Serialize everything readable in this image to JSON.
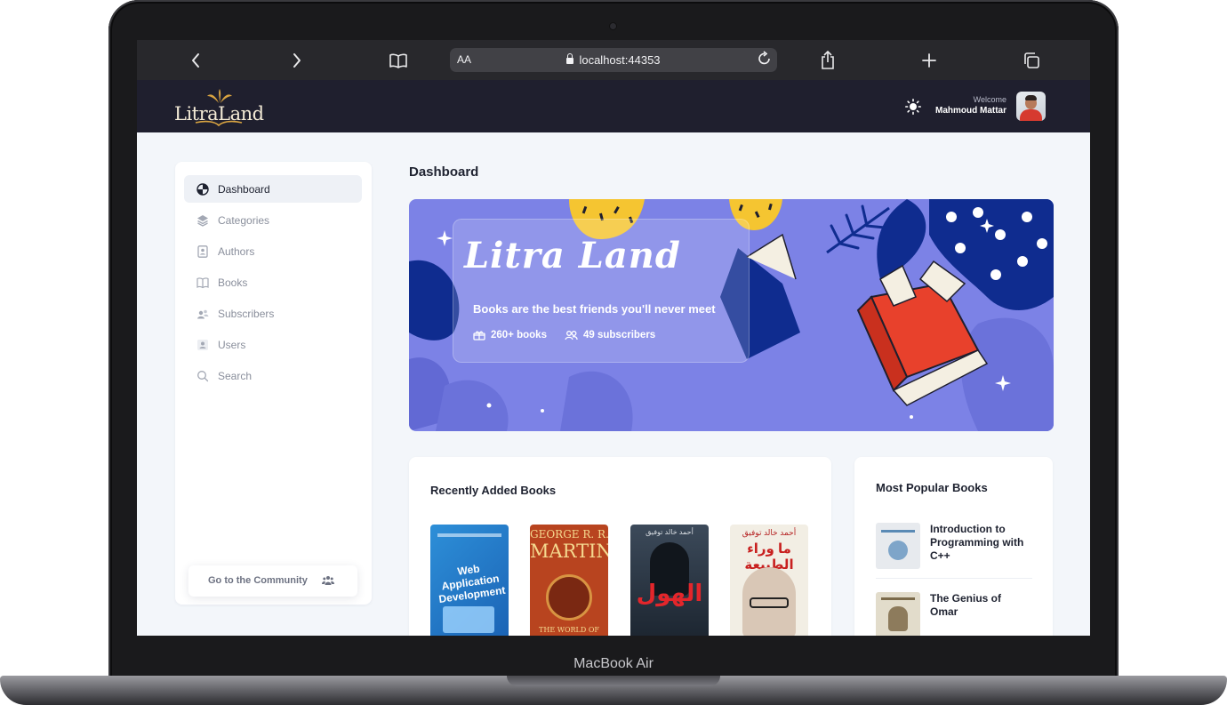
{
  "device": {
    "label": "MacBook Air"
  },
  "browser": {
    "text_size_label": "AA",
    "url": "localhost:44353"
  },
  "header": {
    "logo_text": "LitraLand",
    "welcome_label": "Welcome",
    "user_name": "Mahmoud Mattar"
  },
  "sidebar": {
    "items": [
      {
        "label": "Dashboard",
        "icon": "pie-chart-icon",
        "active": true
      },
      {
        "label": "Categories",
        "icon": "layers-icon"
      },
      {
        "label": "Authors",
        "icon": "contact-card-icon"
      },
      {
        "label": "Books",
        "icon": "open-book-icon"
      },
      {
        "label": "Subscribers",
        "icon": "users-icon"
      },
      {
        "label": "Users",
        "icon": "user-list-icon"
      },
      {
        "label": "Search",
        "icon": "search-icon"
      }
    ],
    "community_label": "Go to the Community"
  },
  "main": {
    "title": "Dashboard",
    "hero": {
      "title": "Litra Land",
      "subtitle": "Books are the best friends you'll never meet",
      "books_stat": "260+ books",
      "subscribers_stat": "49 subscribers"
    },
    "recent": {
      "title": "Recently Added Books",
      "books": [
        {
          "cover_text": "Web Application Development"
        },
        {
          "cover_text_top": "GEORGE R. R.",
          "cover_text_mid": "MARTIN",
          "cover_text_bottom": "THE WORLD OF"
        },
        {
          "cover_text_top": "أحمد خالد توفيق",
          "cover_text_mid": "الهول"
        },
        {
          "cover_text_top": "أحمد خالد توفيق",
          "cover_text_mid": "ما وراء الطبيعة"
        }
      ]
    },
    "popular": {
      "title": "Most Popular Books",
      "items": [
        {
          "title": "Introduction to Programming with C++"
        },
        {
          "title": "The Genius of Omar"
        }
      ]
    }
  },
  "colors": {
    "header_bg": "#1f1f2e",
    "hero_bg": "#7c82e6",
    "accent_red": "#e8412c",
    "accent_yellow": "#f5c531",
    "accent_navy": "#0f2c8f"
  }
}
